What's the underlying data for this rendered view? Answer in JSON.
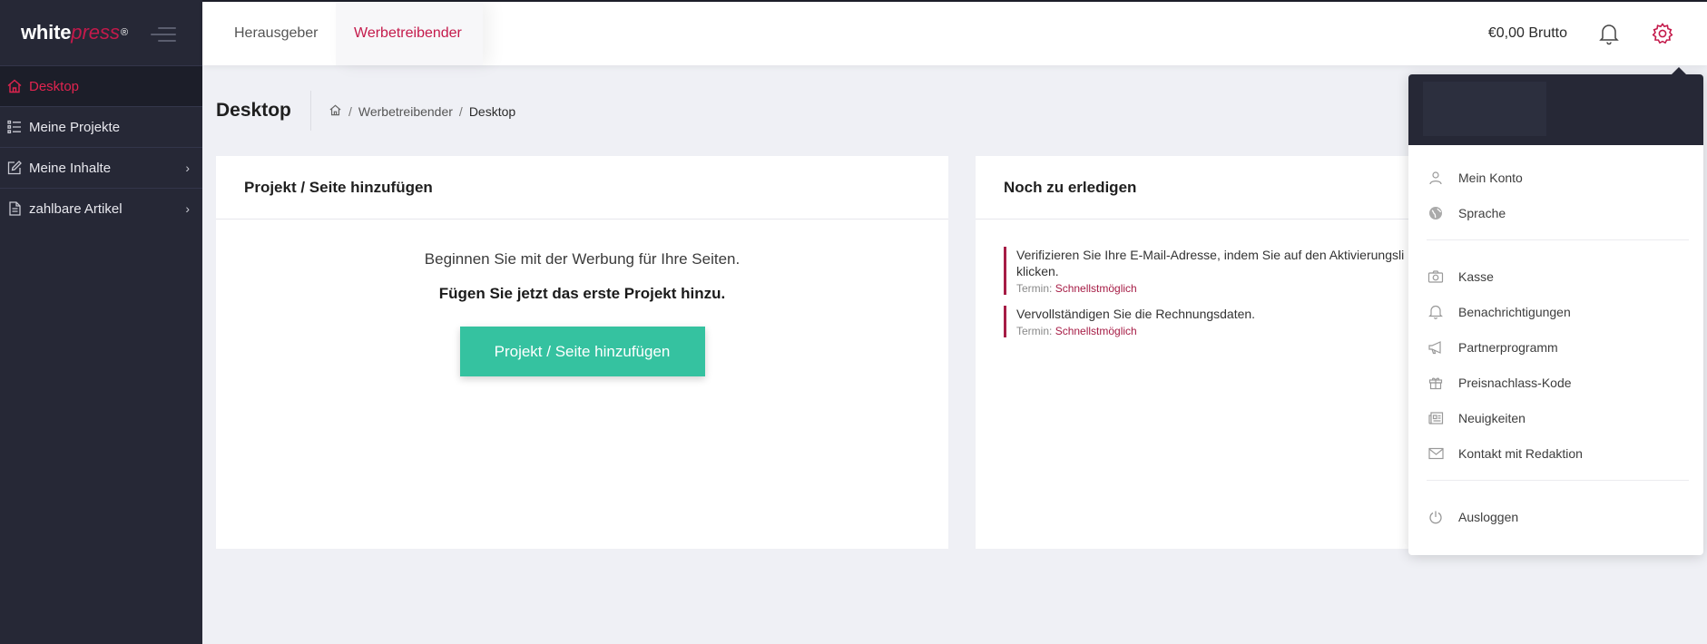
{
  "sidebar": {
    "logo": {
      "white": "white",
      "press": "press",
      "reg": "®"
    },
    "items": [
      {
        "label": "Desktop",
        "active": true,
        "icon": "home-icon"
      },
      {
        "label": "Meine Projekte",
        "active": false,
        "icon": "list-icon"
      },
      {
        "label": "Meine Inhalte",
        "active": false,
        "icon": "edit-icon",
        "has_submenu": true
      },
      {
        "label": "zahlbare Artikel",
        "active": false,
        "icon": "document-icon",
        "has_submenu": true
      }
    ]
  },
  "topbar": {
    "tabs": [
      {
        "label": "Herausgeber",
        "active": false
      },
      {
        "label": "Werbetreibender",
        "active": true
      }
    ],
    "balance": "€0,00 Brutto",
    "icons": [
      "bell-icon",
      "gear-icon"
    ]
  },
  "page": {
    "title": "Desktop",
    "breadcrumb": [
      "Werbetreibender",
      "Desktop"
    ],
    "separator": "/"
  },
  "add_card": {
    "title": "Projekt / Seite hinzufügen",
    "lead": "Beginnen Sie mit der Werbung für Ihre Seiten.",
    "strong": "Fügen Sie jetzt das erste Projekt hinzu.",
    "button": "Projekt / Seite hinzufügen"
  },
  "todo_card": {
    "title": "Noch zu erledigen",
    "items": [
      {
        "text1": "Verifizieren Sie Ihre E-Mail-Adresse, indem Sie auf den Aktivierungsli",
        "text2": "klicken.",
        "deadline_label": "Termin:",
        "deadline": "Schnellstmöglich"
      },
      {
        "text1": "Vervollständigen Sie die Rechnungsdaten.",
        "deadline_label": "Termin:",
        "deadline": "Schnellstmöglich"
      }
    ]
  },
  "dropdown": {
    "group1": [
      {
        "label": "Mein Konto",
        "icon": "user-icon"
      },
      {
        "label": "Sprache",
        "icon": "globe-icon"
      }
    ],
    "group2": [
      {
        "label": "Kasse",
        "icon": "camera-icon"
      },
      {
        "label": "Benachrichtigungen",
        "icon": "bell-icon"
      },
      {
        "label": "Partnerprogramm",
        "icon": "megaphone-icon"
      },
      {
        "label": "Preisnachlass-Kode",
        "icon": "gift-icon"
      },
      {
        "label": "Neuigkeiten",
        "icon": "news-icon"
      },
      {
        "label": "Kontakt mit Redaktion",
        "icon": "mail-icon"
      }
    ],
    "group3": [
      {
        "label": "Ausloggen",
        "icon": "power-icon"
      }
    ]
  },
  "colors": {
    "sidebar_bg": "#262836",
    "accent": "#c41a4b",
    "active_nav": "#e0244f",
    "cta": "#35c2a0",
    "page_bg": "#eff0f5"
  }
}
